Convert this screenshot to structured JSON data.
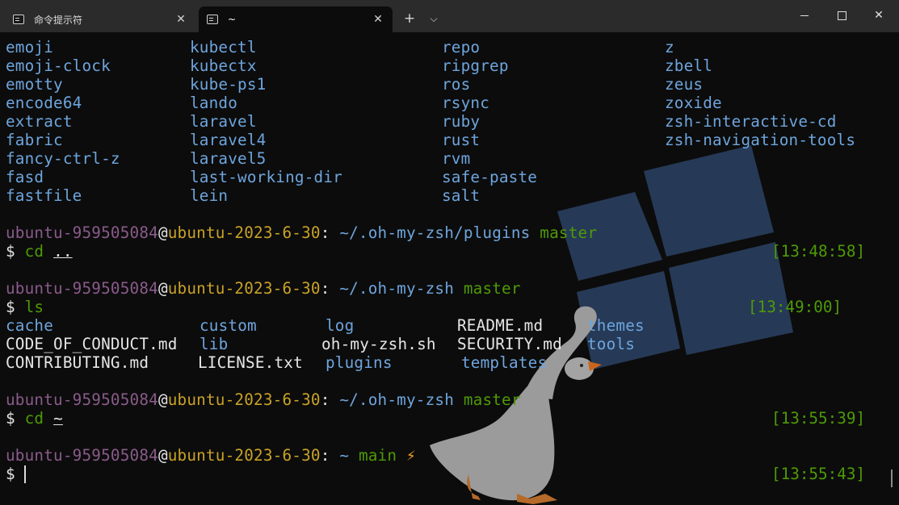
{
  "tabs": [
    {
      "label": "命令提示符",
      "active": false,
      "close": "✕"
    },
    {
      "label": "~",
      "active": true,
      "close": "✕"
    }
  ],
  "tabbar": {
    "new_tab": "+",
    "dropdown": "⌵"
  },
  "window_controls": {
    "close": "✕"
  },
  "plugins": {
    "col1": [
      "emoji",
      "emoji-clock",
      "emotty",
      "encode64",
      "extract",
      "fabric",
      "fancy-ctrl-z",
      "fasd",
      "fastfile"
    ],
    "col2": [
      "kubectl",
      "kubectx",
      "kube-ps1",
      "lando",
      "laravel",
      "laravel4",
      "laravel5",
      "last-working-dir",
      "lein"
    ],
    "col3": [
      "repo",
      "ripgrep",
      "ros",
      "rsync",
      "ruby",
      "rust",
      "rvm",
      "safe-paste",
      "salt"
    ],
    "col4": [
      "z",
      "zbell",
      "zeus",
      "zoxide",
      "zsh-interactive-cd",
      "zsh-navigation-tools"
    ]
  },
  "prompts": [
    {
      "user": "ubuntu-959505084",
      "at": "@",
      "host": "ubuntu-2023-6-30",
      "colon": ":",
      "path": "~/.oh-my-zsh/plugins",
      "branch": "master",
      "dollar": "$",
      "cmd": "cd",
      "arg": "..",
      "time": "[13:48:58]"
    },
    {
      "user": "ubuntu-959505084",
      "at": "@",
      "host": "ubuntu-2023-6-30",
      "colon": ":",
      "path": "~/.oh-my-zsh",
      "branch": "master",
      "dollar": "$",
      "cmd": "ls",
      "arg": "",
      "time": "[13:49:00]"
    },
    {
      "user": "ubuntu-959505084",
      "at": "@",
      "host": "ubuntu-2023-6-30",
      "colon": ":",
      "path": "~/.oh-my-zsh",
      "branch": "master",
      "dollar": "$",
      "cmd": "cd",
      "arg": "~",
      "time": "[13:55:39]"
    },
    {
      "user": "ubuntu-959505084",
      "at": "@",
      "host": "ubuntu-2023-6-30",
      "colon": ":",
      "path": "~",
      "branch": "main",
      "bolt": "⚡",
      "dollar": "$",
      "cmd": "",
      "arg": "",
      "time": "[13:55:43]"
    }
  ],
  "ls_output": {
    "col1": [
      "cache",
      "CODE_OF_CONDUCT.md",
      "CONTRIBUTING.md"
    ],
    "col2": [
      "custom",
      "lib",
      "LICENSE.txt"
    ],
    "col3": [
      "log",
      "oh-my-zsh.sh",
      "plugins"
    ],
    "col4": [
      "README.md",
      "SECURITY.md",
      "templates"
    ],
    "col5": [
      "themes",
      "tools"
    ]
  },
  "colors": {
    "background": "#0c0c0c",
    "titlebar": "#2b2b2b",
    "blue": "#6ea5dd",
    "green": "#4e9a06",
    "purple": "#8a5b8a",
    "yellow": "#c9a227"
  }
}
